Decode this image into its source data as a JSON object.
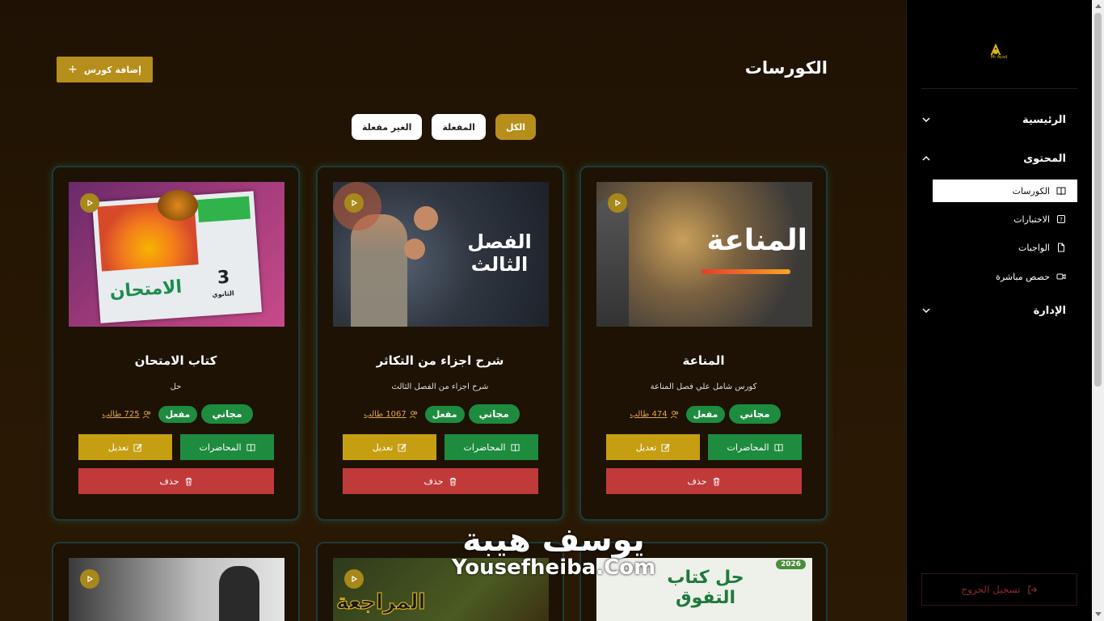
{
  "page": {
    "title": "الكورسات",
    "add_button": "إضافة كورس"
  },
  "filters": [
    {
      "label": "الكل",
      "active": true
    },
    {
      "label": "المفعلة",
      "active": false
    },
    {
      "label": "الغير مفعلة",
      "active": false
    }
  ],
  "courses": [
    {
      "title": "المناعة",
      "description": "كورس شامل علي فصل المناعة",
      "thumb_text": "المناعة",
      "price_badge": "مجاني",
      "status_badge": "مفعل",
      "students": "474 طالب",
      "lectures_label": "المحاضرات",
      "edit_label": "تعديل",
      "delete_label": "حذف"
    },
    {
      "title": "شرح اجزاء من التكاثر",
      "description": "شرح اجزاء من الفصل الثالث",
      "thumb_text": "الفصل الثالث",
      "price_badge": "مجاني",
      "status_badge": "مفعل",
      "students": "1067 طالب",
      "lectures_label": "المحاضرات",
      "edit_label": "تعديل",
      "delete_label": "حذف"
    },
    {
      "title": "كتاب الامتحان",
      "description": "حل",
      "thumb_text": "الامتحان",
      "thumb_num": "3",
      "thumb_sub": "الثانوي",
      "price_badge": "مجاني",
      "status_badge": "مفعل",
      "students": "725 طالب",
      "lectures_label": "المحاضرات",
      "edit_label": "تعديل",
      "delete_label": "حذف"
    }
  ],
  "second_row": [
    {
      "thumb_text": "حل كتاب التفوق",
      "badge": "2026"
    },
    {
      "thumb_text": "المراجعة"
    },
    {
      "thumb_text": ""
    }
  ],
  "watermark": {
    "arabic": "يوسف هيبة",
    "english": "Yousefheiba.Com"
  },
  "logo_text": "Mr Ayad",
  "sidebar": {
    "home": "الرئيسية",
    "content": "المحتوى",
    "sub_items": [
      {
        "label": "الكورسات",
        "icon": "book-icon",
        "active": true
      },
      {
        "label": "الاختبارات",
        "icon": "quiz-icon",
        "active": false
      },
      {
        "label": "الواجبات",
        "icon": "file-icon",
        "active": false
      },
      {
        "label": "حصص مباشرة",
        "icon": "video-icon",
        "active": false
      }
    ],
    "admin": "الإدارة",
    "logout": "تسجيل الخروج"
  },
  "colors": {
    "gold": "#b68e1b",
    "green": "#1e8c3e",
    "red": "#c13a3a",
    "edit": "#c59e12"
  }
}
